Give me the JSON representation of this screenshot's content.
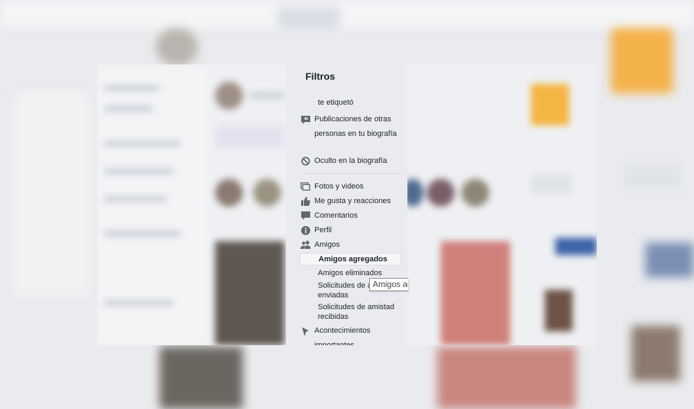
{
  "panel": {
    "title": "Filtros",
    "items": [
      {
        "label": "te etiquetó",
        "icon": "none"
      },
      {
        "label": "Publicaciones de otras personas en tu biografía",
        "icon": "speech-bubble-icon"
      },
      {
        "label": "Oculto en la biografía",
        "icon": "hidden-icon"
      },
      {
        "label": "Fotos y videos",
        "icon": "photos-icon"
      },
      {
        "label": "Me gusta y reacciones",
        "icon": "thumbs-up-icon"
      },
      {
        "label": "Comentarios",
        "icon": "comment-icon"
      },
      {
        "label": "Perfil",
        "icon": "info-icon"
      },
      {
        "label": "Amigos",
        "icon": "friends-icon"
      },
      {
        "label": "Amigos agregados",
        "icon": "none",
        "selected": true
      },
      {
        "label": "Amigos eliminados",
        "icon": "none"
      },
      {
        "label": "Solicitudes de amistad enviadas",
        "icon": "none"
      },
      {
        "label": "Solicitudes de amistad recibidas",
        "icon": "none"
      },
      {
        "label": "Acontecimientos importantes",
        "icon": "flag-icon"
      }
    ]
  },
  "tooltip": {
    "text": "Amigos agregados"
  },
  "colors": {
    "panel_bg": "#e9ebee",
    "text": "#1d2129",
    "icon": "#606770",
    "selected_bg": "#f5f6f7"
  }
}
